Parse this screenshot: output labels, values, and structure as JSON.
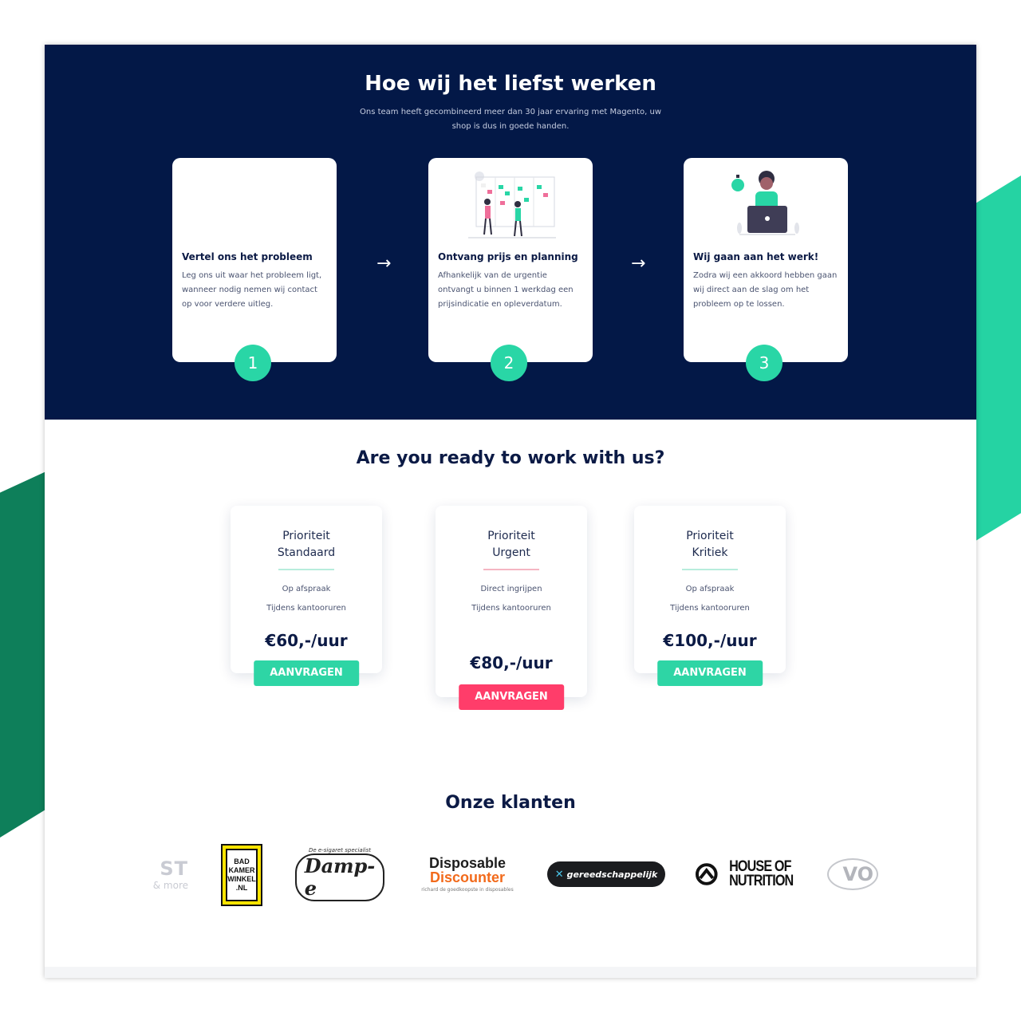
{
  "colors": {
    "navy": "#031847",
    "accent_green": "#29d6a6",
    "accent_red": "#ff3d6a",
    "deco_dark_green": "#0e7f5a",
    "deco_light_green": "#25d3a3"
  },
  "hero": {
    "title": "Hoe wij het liefst werken",
    "subtitle": "Ons team heeft gecombineerd meer dan 30 jaar ervaring met Magento, uw shop is dus in goede handen.",
    "steps": [
      {
        "number": "1",
        "title": "Vertel ons het probleem",
        "text": "Leg ons uit waar het probleem ligt, wanneer nodig nemen wij contact op voor verdere uitleg.",
        "illustration": "none"
      },
      {
        "number": "2",
        "title": "Ontvang prijs en planning",
        "text": "Afhankelijk van de urgentie ontvangt u binnen 1 werkdag een prijsindicatie en opleverdatum.",
        "illustration": "planning-board-illustration"
      },
      {
        "number": "3",
        "title": "Wij gaan aan het werk!",
        "text": "Zodra wij een akkoord hebben gaan wij direct aan de slag om het probleem op te lossen.",
        "illustration": "person-laptop-illustration"
      }
    ],
    "arrow_icon": "→"
  },
  "cta": {
    "title_before": "Are you ",
    "title_highlight": "ready",
    "title_after": " to work with us?"
  },
  "pricing": [
    {
      "name_line1": "Prioriteit",
      "name_line2": "Standaard",
      "features": [
        "Op afspraak",
        "Tijdens kantooruren"
      ],
      "price": "€60,-/uur",
      "button": "AANVRAGEN"
    },
    {
      "name_line1": "Prioriteit",
      "name_line2": "Urgent",
      "features": [
        "Direct ingrijpen",
        "Tijdens kantooruren"
      ],
      "price": "€80,-/uur",
      "button": "AANVRAGEN"
    },
    {
      "name_line1": "Prioriteit",
      "name_line2": "Kritiek",
      "features": [
        "Op afspraak",
        "Tijdens kantooruren"
      ],
      "price": "€100,-/uur",
      "button": "AANVRAGEN"
    }
  ],
  "clients": {
    "title": "Onze klanten",
    "logos": {
      "lyst": {
        "big": "ST",
        "small": "& more"
      },
      "badkamerwinkel": [
        "BAD",
        "KAMER",
        "WINKEL",
        ".NL"
      ],
      "damp": {
        "tag": "De e-sigaret specialist",
        "word": "Damp-e"
      },
      "disposable": {
        "line1": "Disposable",
        "line2": "Discounter",
        "line3": "richard de goedkoopste in disposables"
      },
      "gereedschappelijk": {
        "mark": "✕",
        "word": "gereedschappelijk"
      },
      "house_of_nutrition": {
        "line1": "HOUSE OF",
        "line2": "NUTRITION"
      },
      "vo": {
        "word": "VO"
      }
    }
  }
}
